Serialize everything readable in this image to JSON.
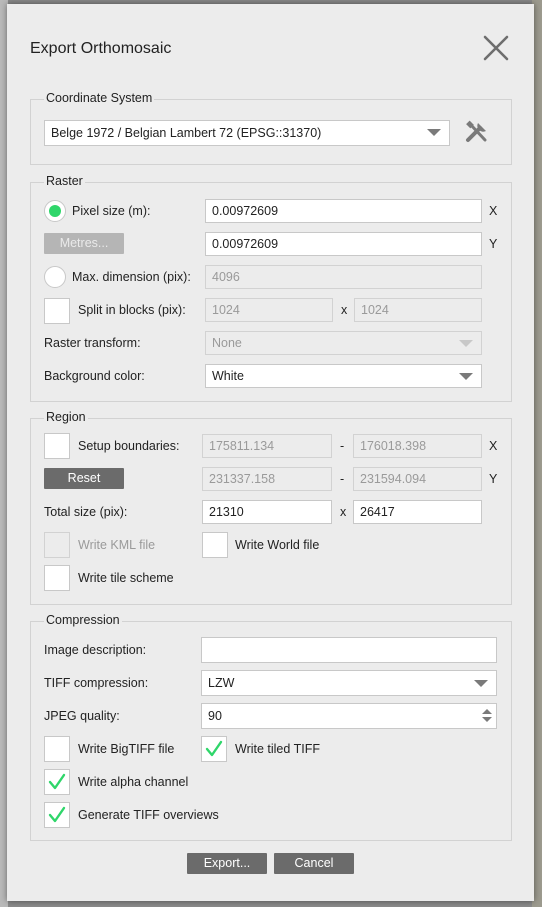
{
  "dialog": {
    "title": "Export Orthomosaic",
    "close_icon": "close-icon"
  },
  "coordinate_system": {
    "group_title": "Coordinate System",
    "value": "Belge 1972 / Belgian Lambert 72 (EPSG::31370)",
    "settings_icon": "tools-icon"
  },
  "raster": {
    "group_title": "Raster",
    "pixel_size_label": "Pixel size (m):",
    "pixel_size_selected": true,
    "pixel_x": "0.00972609",
    "pixel_y": "0.00972609",
    "axis_x": "X",
    "axis_y": "Y",
    "metres_button": "Metres...",
    "max_dimension_label": "Max. dimension (pix):",
    "max_dimension_value": "4096",
    "split_label": "Split in blocks (pix):",
    "split_x": "1024",
    "split_sep": "x",
    "split_y": "1024",
    "transform_label": "Raster transform:",
    "transform_value": "None",
    "background_label": "Background color:",
    "background_value": "White"
  },
  "region": {
    "group_title": "Region",
    "setup_label": "Setup boundaries:",
    "x_min": "175811.134",
    "x_max": "176018.398",
    "y_min": "231337.158",
    "y_max": "231594.094",
    "dash": "-",
    "axis_x": "X",
    "axis_y": "Y",
    "reset_button": "Reset",
    "total_label": "Total size (pix):",
    "total_x": "21310",
    "total_sep": "x",
    "total_y": "26417",
    "kml_label": "Write KML file",
    "world_label": "Write World file",
    "tile_label": "Write tile scheme"
  },
  "compression": {
    "group_title": "Compression",
    "description_label": "Image description:",
    "description_value": "",
    "tiff_label": "TIFF compression:",
    "tiff_value": "LZW",
    "jpeg_label": "JPEG quality:",
    "jpeg_value": "90",
    "bigtiff_label": "Write BigTIFF file",
    "bigtiff_checked": false,
    "tiled_label": "Write tiled TIFF",
    "tiled_checked": true,
    "alpha_label": "Write alpha channel",
    "alpha_checked": true,
    "overviews_label": "Generate TIFF overviews",
    "overviews_checked": true
  },
  "footer": {
    "export_button": "Export...",
    "cancel_button": "Cancel"
  },
  "colors": {
    "accent": "#2fd66a",
    "button": "#6b6b6b",
    "dialog_bg": "#ececec"
  }
}
